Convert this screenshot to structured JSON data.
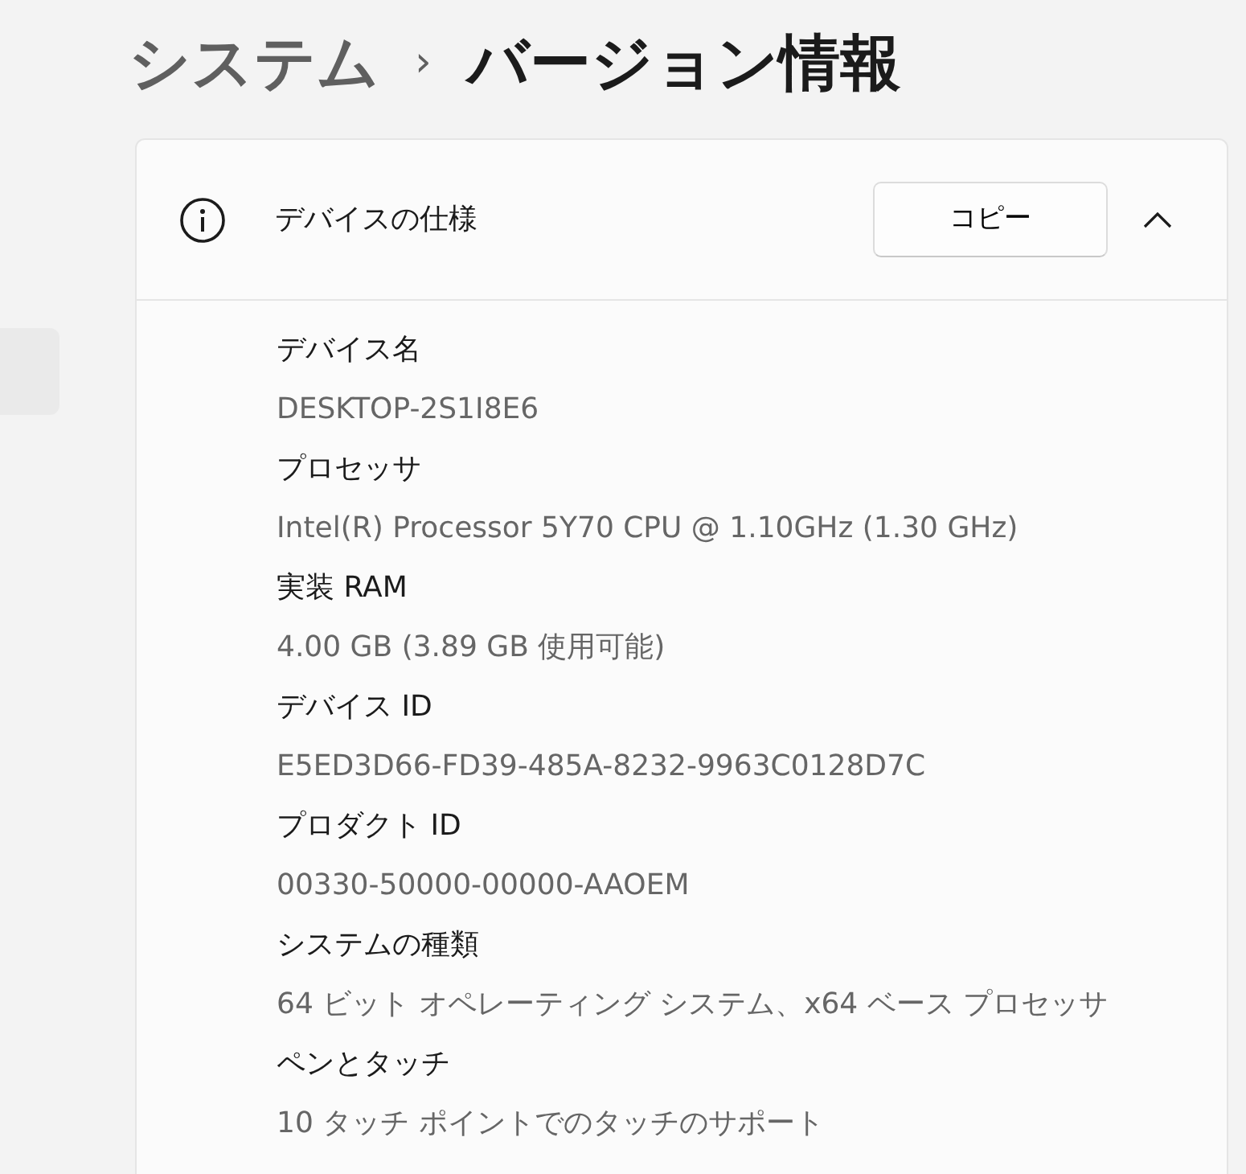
{
  "breadcrumb": [
    {
      "label": "システム",
      "current": false
    },
    {
      "label": "バージョン情報",
      "current": true
    }
  ],
  "breadcrumb_separator": "›",
  "section": {
    "title": "デバイスの仕様",
    "button": "コピー",
    "expanded": true
  },
  "specs": [
    {
      "label": "デバイス名",
      "value": "DESKTOP-2S1I8E6"
    },
    {
      "label": "プロセッサ",
      "value": "Intel(R) Processor 5Y70 CPU @ 1.10GHz (1.30 GHz)"
    },
    {
      "label": "実装 RAM",
      "value": "4.00 GB (3.89 GB 使用可能)"
    },
    {
      "label": "デバイス ID",
      "value": "E5ED3D66-FD39-485A-8232-9963C0128D7C"
    },
    {
      "label": "プロダクト ID",
      "value": "00330-50000-00000-AAOEM"
    },
    {
      "label": "システムの種類",
      "value": "64 ビット オペレーティング システム、x64 ベース プロセッサ"
    },
    {
      "label": "ペンとタッチ",
      "value": "10 タッチ ポイントでのタッチのサポート"
    }
  ]
}
